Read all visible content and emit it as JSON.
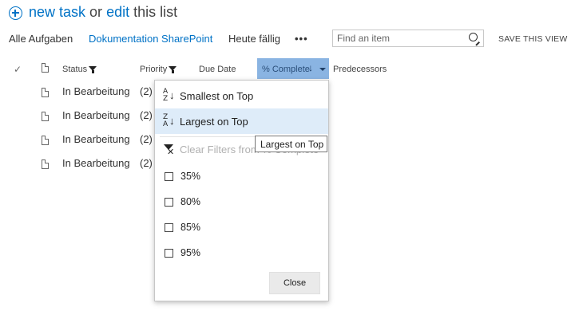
{
  "header": {
    "add_icon": "plus-circle-icon",
    "new_task_link": "new task",
    "or_text": " or ",
    "edit_link": "edit",
    "this_list_text": " this list"
  },
  "views": {
    "items": [
      {
        "label": "Alle Aufgaben",
        "selected": false
      },
      {
        "label": "Dokumentation SharePoint",
        "selected": true
      },
      {
        "label": "Heute fällig",
        "selected": false
      }
    ],
    "more_label": "•••",
    "search_placeholder": "Find an item",
    "save_view_label": "SAVE THIS VIEW"
  },
  "columns": {
    "status": "Status",
    "priority": "Priority",
    "due_date": "Due Date",
    "percent_complete": "% Complete",
    "predecessors": "Predecessors"
  },
  "rows": [
    {
      "status": "In Bearbeitung",
      "priority": "(2)"
    },
    {
      "status": "In Bearbeitung",
      "priority": "(2)"
    },
    {
      "status": "In Bearbeitung",
      "priority": "(2)"
    },
    {
      "status": "In Bearbeitung",
      "priority": "(2)"
    }
  ],
  "dropdown": {
    "sort_ascending": "Smallest on Top",
    "sort_descending": "Largest on Top",
    "clear_filters": "Clear Filters from % Complete",
    "filter_options": [
      "35%",
      "80%",
      "85%",
      "95%"
    ],
    "close_label": "Close"
  },
  "tooltip": "Largest on Top",
  "colors": {
    "link_blue": "#0072c6",
    "header_highlight": "#8ab4e2",
    "menu_hover": "#deecf9"
  }
}
